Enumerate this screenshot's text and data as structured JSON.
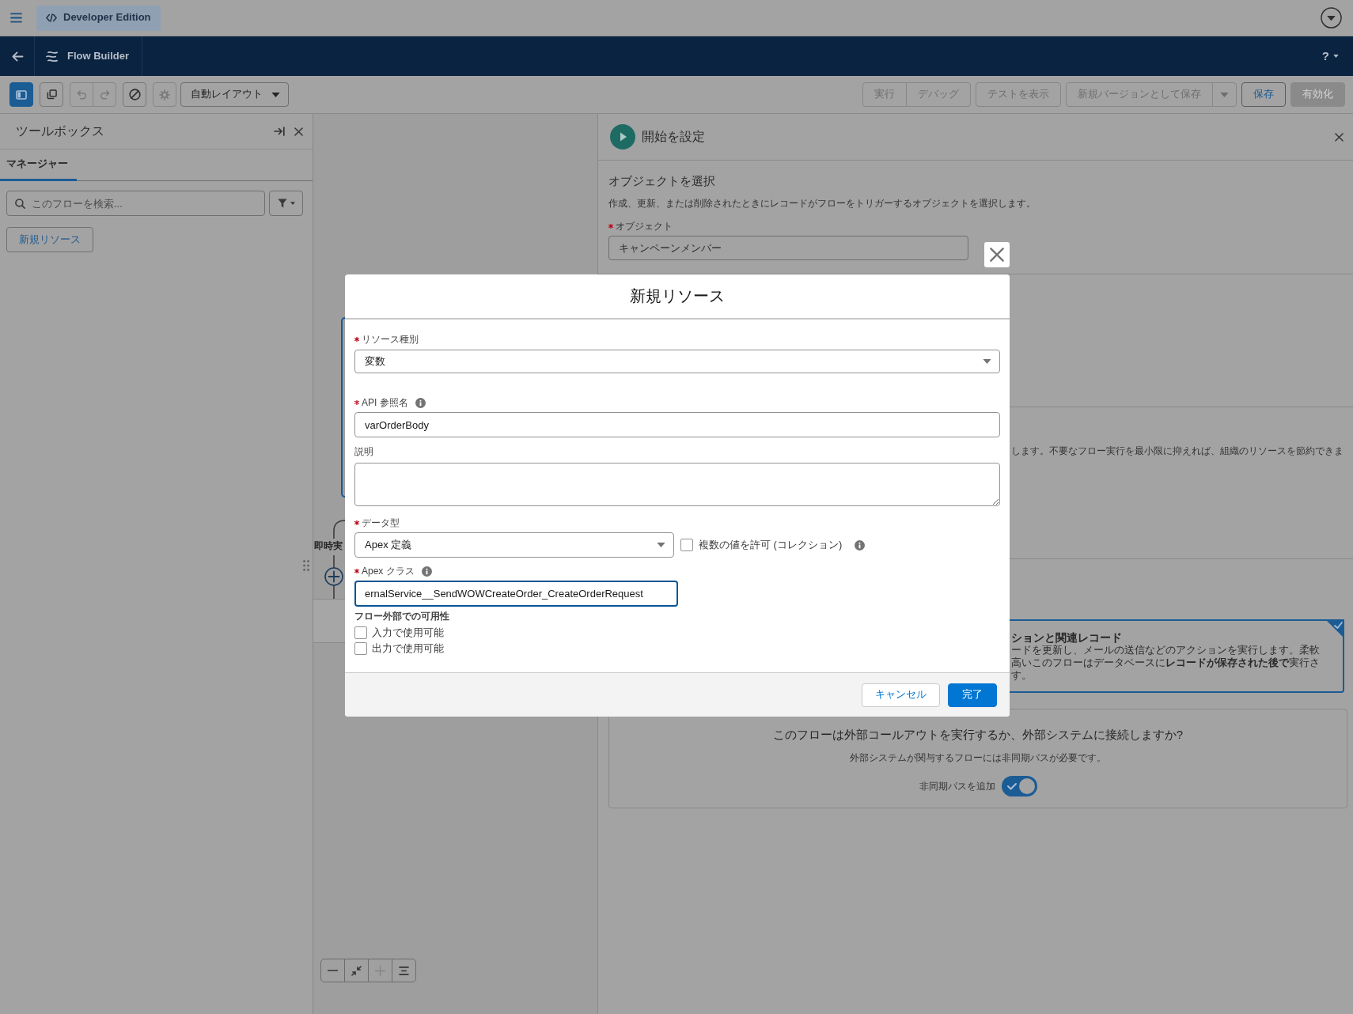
{
  "top_bar": {
    "edition_badge": "Developer Edition"
  },
  "nav_bar": {
    "app_title": "Flow Builder",
    "help_label": "?"
  },
  "toolbar": {
    "icon_buttons": [
      {
        "kind": "panel",
        "selected": true,
        "disabled": false
      },
      {
        "kind": "copy",
        "selected": false,
        "disabled": false
      },
      {
        "kind": "undo",
        "selected": false,
        "disabled": true
      },
      {
        "kind": "redo",
        "selected": false,
        "disabled": true
      },
      {
        "kind": "ban",
        "selected": false,
        "disabled": false
      },
      {
        "kind": "gear",
        "selected": false,
        "disabled": true
      }
    ],
    "layout_dropdown": "自動レイアウト",
    "action_groups": [
      {
        "buttons": [
          {
            "kind": "neutral",
            "label": "実行",
            "disabled": true
          },
          {
            "kind": "neutral",
            "label": "デバッグ",
            "disabled": true
          }
        ]
      },
      {
        "buttons": [
          {
            "kind": "neutral",
            "label": "テストを表示",
            "disabled": true
          }
        ]
      },
      {
        "buttons": [
          {
            "kind": "neutral",
            "label": "新規バージョンとして保存",
            "disabled": true
          },
          {
            "kind": "menu",
            "disabled": true
          }
        ]
      },
      {
        "buttons": [
          {
            "kind": "neutral",
            "label": "保存",
            "disabled": false
          }
        ]
      },
      {
        "buttons": [
          {
            "kind": "brand",
            "label": "有効化",
            "disabled": true
          }
        ]
      }
    ]
  },
  "toolbox": {
    "title": "ツールボックス",
    "tabs": [
      {
        "label": "マネージャー",
        "selected": true
      }
    ],
    "search": {
      "placeholder": "このフローを検索..."
    },
    "new_resource_button": "新規リソース"
  },
  "canvas": {
    "path_label": "即時実",
    "zoom_controls": [
      {
        "kind": "zoom-out",
        "disabled": false
      },
      {
        "kind": "fit",
        "disabled": false
      },
      {
        "kind": "zoom-in",
        "disabled": true
      },
      {
        "kind": "center",
        "disabled": false
      }
    ]
  },
  "start_panel": {
    "title": "開始を設定",
    "section_title": "オブジェクトを選択",
    "section_description": "作成、更新、または削除されたときにレコードがフローをトリガーするオブジェクトを選択します。",
    "object_field": {
      "label": "オブジェクト",
      "required": true,
      "value": "キャンペーンメンバー"
    },
    "hidden_section_text": "します。不要なフロー実行を最小限に抑えれば、組織のリソースを節約できま",
    "option_card": {
      "selected": true,
      "title": "ションと関連レコード",
      "lines": [
        "ードを更新し、メールの送信などのアクションを実行します。柔軟",
        "高いこのフローはデータベースに**レコードが保存された後で**実行さ",
        "す。"
      ]
    },
    "callout_card": {
      "title": "このフローは外部コールアウトを実行するか、外部システムに接続しますか?",
      "description": "外部システムが関与するフローには非同期パスが必要です。",
      "toggle": {
        "label": "非同期パスを追加",
        "on": true
      }
    }
  },
  "dialog": {
    "title": "新規リソース",
    "fields": [
      {
        "kind": "select",
        "label": "リソース種別",
        "required": true,
        "value": "変数"
      },
      {
        "kind": "text",
        "label": "API 参照名",
        "required": true,
        "info": true,
        "value": "varOrderBody",
        "focused": false
      },
      {
        "kind": "textarea",
        "label": "説明",
        "required": false
      },
      {
        "kind": "select-with-checkbox",
        "label": "データ型",
        "required": true,
        "value": "Apex 定義",
        "checkbox": {
          "label": "複数の値を許可 (コレクション)",
          "checked": false,
          "info": true
        }
      },
      {
        "kind": "text",
        "label": "Apex クラス",
        "required": true,
        "info": true,
        "value": "ernalService__SendWOWCreateOrder_CreateOrderRequest",
        "focused": true
      }
    ],
    "availability": {
      "title": "フロー外部での可用性",
      "options": [
        {
          "label": "入力で使用可能",
          "checked": false
        },
        {
          "label": "出力で使用可能",
          "checked": false
        }
      ]
    },
    "buttons": [
      {
        "kind": "neutral",
        "label": "キャンセル"
      },
      {
        "kind": "brand",
        "label": "完了"
      }
    ]
  }
}
